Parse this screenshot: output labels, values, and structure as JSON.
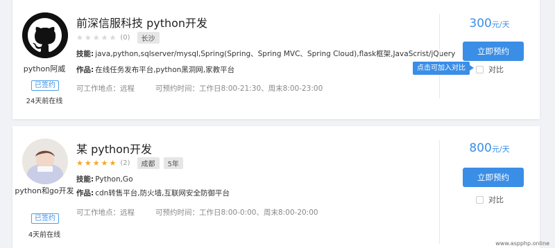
{
  "listings": [
    {
      "title": "前深信服科技  python开发",
      "username": "python阿威",
      "signed_label": "已签约",
      "online_status": "24天前在线",
      "rating": 0,
      "rating_count": "(0)",
      "tags": [
        "长沙"
      ],
      "skills_label": "技能:",
      "skills": "java,python,sqlserver/mysql,Spring(Spring、Spring MVC、Spring Cloud),flask框架,JavaScrist/jQuery",
      "works_label": "作品:",
      "works": "在线任务发布平台,python黑洞网,家教平台",
      "location": "可工作地点：远程",
      "available_time": "可预约时间：工作日8:00-21:30、周末8:00-23:00",
      "price_value": "300",
      "price_unit": "元/天",
      "book_label": "立即预约",
      "compare_label": "对比",
      "compare_tip": "点击可加入对比",
      "avatar_icon": "github-octocat-icon"
    },
    {
      "title": "某  python开发",
      "username": "python和go开发",
      "signed_label": "已签约",
      "online_status": "4天前在线",
      "rating": 5,
      "rating_count": "(2)",
      "tags": [
        "成都",
        "5年"
      ],
      "skills_label": "技能:",
      "skills": "Python,Go",
      "works_label": "作品:",
      "works": "cdn转售平台,防火墙,互联网安全防御平台",
      "location": "可工作地点：远程",
      "available_time": "可预约时间：工作日8:00-0:00、周末8:00-20:00",
      "price_value": "800",
      "price_unit": "元/天",
      "book_label": "立即预约",
      "compare_label": "对比",
      "avatar_icon": "child-photo-avatar"
    }
  ],
  "watermark": "www.aspphp.online",
  "colors": {
    "accent": "#3a8ee6",
    "star": "#f5a623",
    "tag_bg": "#e6e6e6"
  }
}
